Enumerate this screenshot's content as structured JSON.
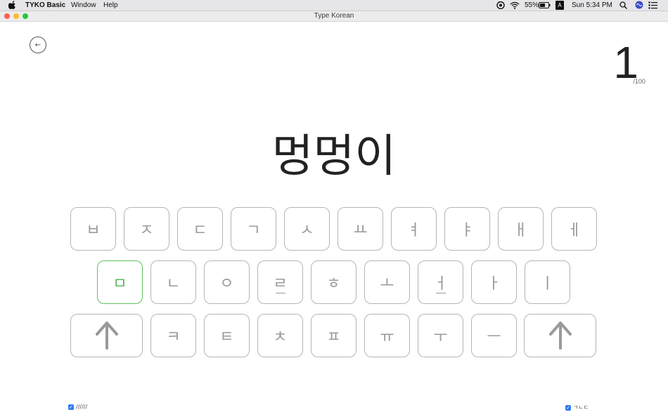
{
  "menubar": {
    "app_name": "TYKO Basic",
    "menus": [
      "Window",
      "Help"
    ],
    "battery": "55%",
    "input_source": "A",
    "clock": "Sun 5:34 PM"
  },
  "window": {
    "title": "Type Korean"
  },
  "counter": {
    "current": "1",
    "total": "/100"
  },
  "word": "멍멍이",
  "keyboard": {
    "row1": [
      "ㅂ",
      "ㅈ",
      "ㄷ",
      "ㄱ",
      "ㅅ",
      "ㅛ",
      "ㅕ",
      "ㅑ",
      "ㅐ",
      "ㅔ"
    ],
    "row2": [
      "ㅁ",
      "ㄴ",
      "ㅇ",
      "ㄹ",
      "ㅎ",
      "ㅗ",
      "ㅓ",
      "ㅏ",
      "ㅣ"
    ],
    "row3": [
      "ㅋ",
      "ㅌ",
      "ㅊ",
      "ㅍ",
      "ㅠ",
      "ㅜ",
      "ㅡ"
    ],
    "highlighted": "ㅁ",
    "highlight_color": "#5cc35c"
  },
  "options": {
    "left_label": "//////",
    "right_label": "ㄱㄴㄷ"
  }
}
